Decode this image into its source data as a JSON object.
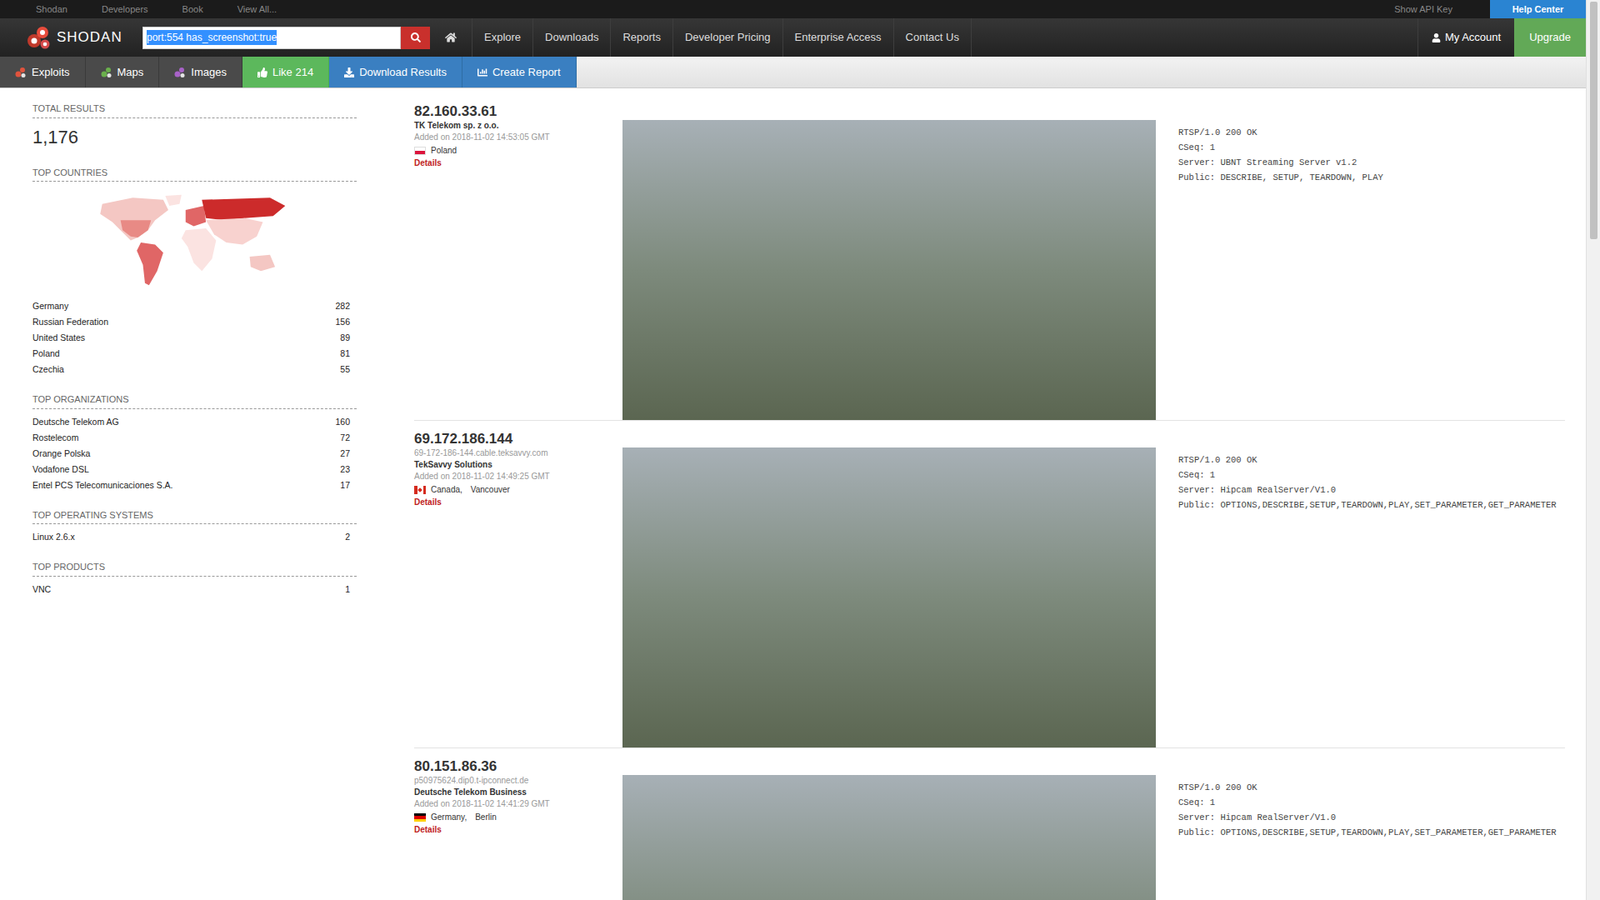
{
  "top_bar": {
    "links": [
      "Shodan",
      "Developers",
      "Book",
      "View All..."
    ],
    "api_key": "Show API Key",
    "help": "Help Center"
  },
  "nav": {
    "brand": "SHODAN",
    "search": {
      "value": "port:554 has_screenshot:true",
      "selected": true
    },
    "links": [
      "Explore",
      "Downloads",
      "Reports",
      "Developer Pricing",
      "Enterprise Access",
      "Contact Us"
    ],
    "account": "My Account",
    "upgrade": "Upgrade"
  },
  "toolbar": [
    {
      "label": "Exploits",
      "kind": "dots",
      "color": "#e0533d"
    },
    {
      "label": "Maps",
      "kind": "dots",
      "color": "#6ab04c"
    },
    {
      "label": "Images",
      "kind": "dots",
      "color": "#a862c8"
    },
    {
      "label": "Like 214",
      "kind": "like"
    },
    {
      "label": "Download Results",
      "kind": "download"
    },
    {
      "label": "Create Report",
      "kind": "report"
    }
  ],
  "sidebar": {
    "total_title": "TOTAL RESULTS",
    "total": "1,176",
    "sections": [
      {
        "title": "TOP COUNTRIES",
        "map": true,
        "items": [
          {
            "label": "Germany",
            "count": "282"
          },
          {
            "label": "Russian Federation",
            "count": "156"
          },
          {
            "label": "United States",
            "count": "89"
          },
          {
            "label": "Poland",
            "count": "81"
          },
          {
            "label": "Czechia",
            "count": "55"
          }
        ]
      },
      {
        "title": "TOP ORGANIZATIONS",
        "map": false,
        "items": [
          {
            "label": "Deutsche Telekom AG",
            "count": "160"
          },
          {
            "label": "Rostelecom",
            "count": "72"
          },
          {
            "label": "Orange Polska",
            "count": "27"
          },
          {
            "label": "Vodafone DSL",
            "count": "23"
          },
          {
            "label": "Entel PCS Telecomunicaciones S.A.",
            "count": "17"
          }
        ]
      },
      {
        "title": "TOP OPERATING SYSTEMS",
        "map": false,
        "items": [
          {
            "label": "Linux 2.6.x",
            "count": "2"
          }
        ]
      },
      {
        "title": "TOP PRODUCTS",
        "map": false,
        "items": [
          {
            "label": "VNC",
            "count": "1"
          }
        ]
      }
    ]
  },
  "results": [
    {
      "ip": "82.160.33.61",
      "org": "TK Telekom sp. z o.o.",
      "added": "Added on 2018-11-02 14:53:05 GMT",
      "kind": "pl",
      "location": [
        "Poland"
      ],
      "details": "Details",
      "banner": [
        "RTSP/1.0 200 OK",
        "CSeq: 1",
        "Server: UBNT Streaming Server v1.2",
        "Public: DESCRIBE, SETUP, TEARDOWN, PLAY"
      ]
    },
    {
      "ip": "69.172.186.144",
      "hostname": "69-172-186-144.cable.teksavvy.com",
      "org": "TekSavvy Solutions",
      "added": "Added on 2018-11-02 14:49:25 GMT",
      "kind": "ca",
      "location": [
        "Canada,",
        "Vancouver"
      ],
      "details": "Details",
      "banner": [
        "RTSP/1.0 200 OK",
        "CSeq: 1",
        "Server: Hipcam RealServer/V1.0",
        "Public: OPTIONS,DESCRIBE,SETUP,TEARDOWN,PLAY,SET_PARAMETER,GET_PARAMETER"
      ]
    },
    {
      "ip": "80.151.86.36",
      "hostname": "p50975624.dip0.t-ipconnect.de",
      "org": "Deutsche Telekom Business",
      "added": "Added on 2018-11-02 14:41:29 GMT",
      "kind": "de",
      "location": [
        "Germany,",
        "Berlin"
      ],
      "details": "Details",
      "banner": [
        "RTSP/1.0 200 OK",
        "CSeq: 1",
        "Server: Hipcam RealServer/V1.0",
        "Public: OPTIONS,DESCRIBE,SETUP,TEARDOWN,PLAY,SET_PARAMETER,GET_PARAMETER"
      ]
    }
  ]
}
